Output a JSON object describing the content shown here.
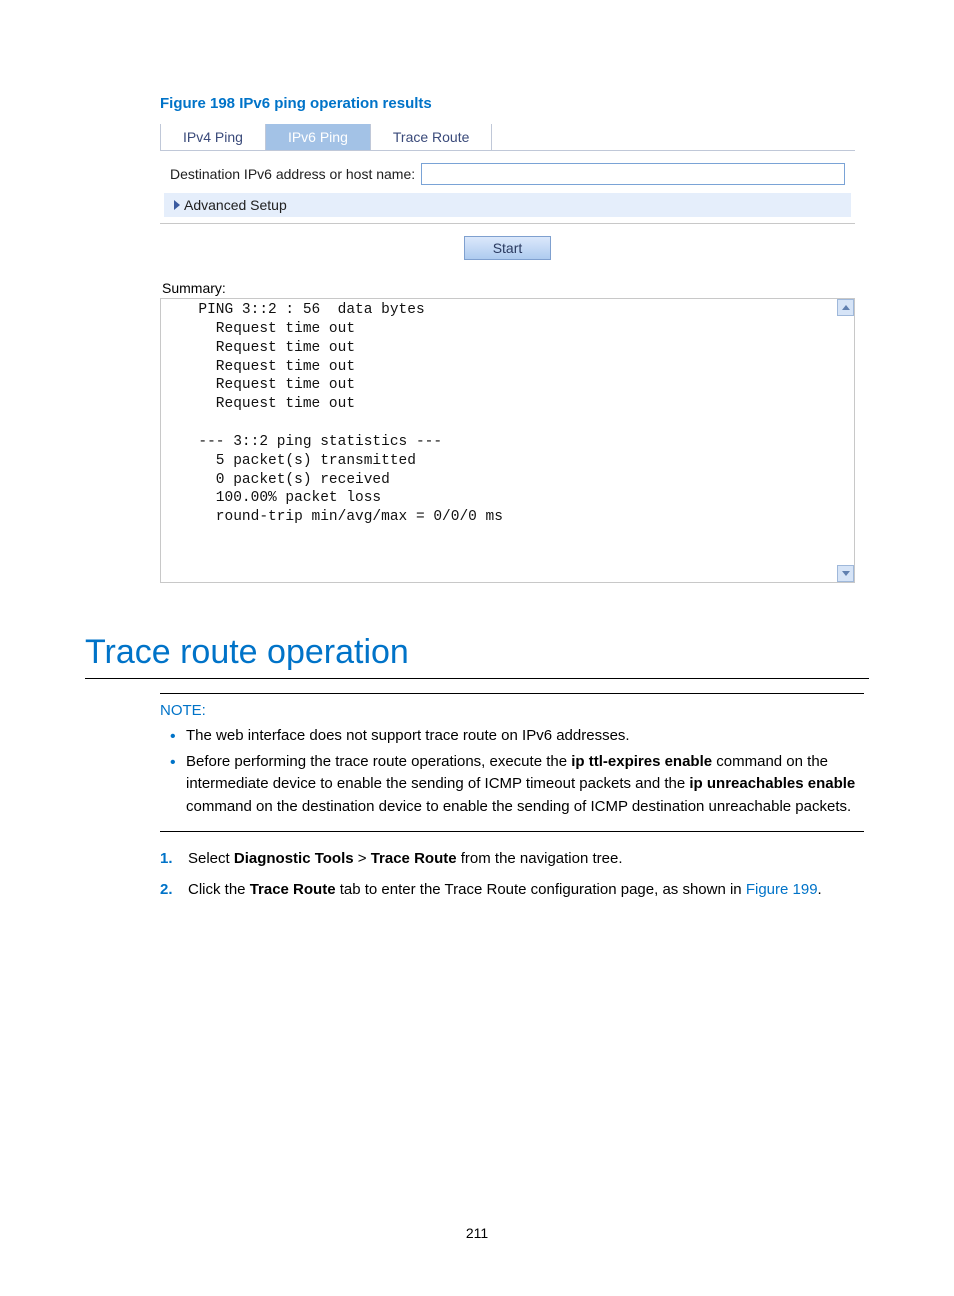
{
  "figure_caption": "Figure 198 IPv6 ping operation results",
  "tabs": {
    "ipv4": "IPv4 Ping",
    "ipv6": "IPv6 Ping",
    "trace": "Trace Route"
  },
  "form": {
    "dest_label": "Destination IPv6 address or host name:",
    "dest_value": "",
    "advanced": "Advanced Setup",
    "start": "Start"
  },
  "summary_label": "Summary:",
  "summary_text": "  PING 3::2 : 56  data bytes\n    Request time out\n    Request time out\n    Request time out\n    Request time out\n    Request time out\n\n  --- 3::2 ping statistics ---\n    5 packet(s) transmitted\n    0 packet(s) received\n    100.00% packet loss\n    round-trip min/avg/max = 0/0/0 ms",
  "section_heading": "Trace route operation",
  "note": {
    "label": "NOTE:",
    "item1": "The web interface does not support trace route on IPv6 addresses.",
    "item2_a": "Before performing the trace route operations, execute the ",
    "item2_b": "ip ttl-expires enable",
    "item2_c": " command on the intermediate device to enable the sending of ICMP timeout packets and the ",
    "item2_d": "ip unreachables enable",
    "item2_e": " command on the destination device to enable the sending of ICMP destination unreachable packets."
  },
  "steps": {
    "s1_num": "1.",
    "s1_a": "Select ",
    "s1_b": "Diagnostic Tools",
    "s1_c": " > ",
    "s1_d": "Trace Route",
    "s1_e": " from the navigation tree.",
    "s2_num": "2.",
    "s2_a": "Click the ",
    "s2_b": "Trace Route",
    "s2_c": " tab to enter the Trace Route configuration page, as shown in ",
    "s2_d": "Figure 199",
    "s2_e": "."
  },
  "page_number": "211"
}
